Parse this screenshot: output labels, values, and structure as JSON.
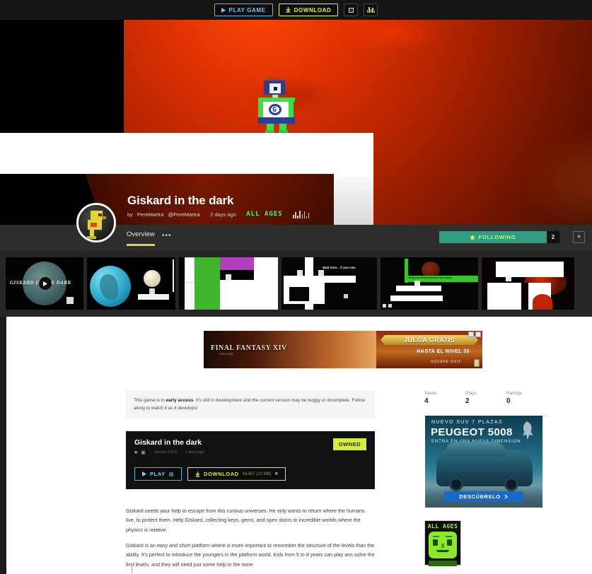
{
  "topbar": {
    "play_game_label": "PLAY GAME",
    "download_label": "DOWNLOAD",
    "play_icon": "play-triangle-icon",
    "download_icon": "download-arrow-icon",
    "fullscreen_icon": "fullscreen-icon",
    "stats_icon": "stats-bars-icon"
  },
  "hero": {
    "character": "pixel-robot-giskard",
    "chest_letter": "G"
  },
  "title": {
    "game_title": "Giskard in the dark",
    "by_prefix": "by",
    "author": "PereMartra",
    "handle": "@PereMartra",
    "posted": "2 days ago",
    "age_rating": "ALL AGES",
    "sep": "·"
  },
  "tabs": {
    "overview_label": "Overview",
    "more_label": "•••",
    "following_label": "FOLLOWING",
    "following_icon": "check-badge-icon",
    "following_count": "2",
    "add_label": "+"
  },
  "shots": {
    "first_caption": "GISKARD IN THE DARK",
    "play_icon": "play-circle-icon",
    "tip_text": "Wait here... if you can.",
    "green_bar_text": "Bring your friend before the door opens"
  },
  "ad_banner": {
    "brand": "FINAL FANTASY XIV",
    "brand_sub": "ONLINE",
    "headline": "JUEGA GRATIS",
    "subline": "HASTA EL NIVEL 35",
    "publisher": "SQUARE ENIX",
    "adchoices_icon": "adchoices-icon",
    "close_icon": "close-icon"
  },
  "notice": {
    "part1": "This game is in ",
    "bold": "early access",
    "part2": ". It's still in development and the current version may be buggy or incomplete. Follow along to watch it as it develops!"
  },
  "stats": [
    {
      "label": "Views",
      "value": "4"
    },
    {
      "label": "Plays",
      "value": "2"
    },
    {
      "label": "Ratings",
      "value": "0"
    }
  ],
  "download_panel": {
    "title": "Giskard in the dark",
    "platform_icons": "windows-linux-icons",
    "version": "Version 0.8.0",
    "updated": "2 days ago",
    "owned_badge": "OWNED",
    "play_label": "PLAY",
    "play_icon": "play-triangle-icon",
    "play_platform_icon": "monitor-icon",
    "download_label": "DOWNLOAD",
    "download_icon": "download-arrow-icon",
    "download_size": "64-BIT (23 MB)",
    "download_platform_icon": "windows-icon"
  },
  "description": {
    "p1": "Giskard needs your help to escape from this curious universes. He only wants to return where the humans live, to protect them. Help Giskard, collecting keys, gems, and open doors to incredible worlds where the physics is relative.",
    "p2": "Giskard is an easy and short platform where is more important to remember the structure of the levels than the ability. It's perfect to introduce the youngers in the platform world. Kids from 5 to 8 years can play ans solve the first levels, and they will need just some help in the more"
  },
  "ad_sidebar": {
    "eyebrow": "NUEVO SUV 7 PLAZAS",
    "model": "PEUGEOT 5008",
    "tagline": "ENTRA EN UNA NUEVA DIMENSION",
    "cta": "DESCÚBRELO",
    "cta_icon": "chevron-right-icon",
    "logo_icon": "peugeot-lion-icon"
  },
  "rating_badge": {
    "title": "ALL AGES",
    "face_icon": "pixel-face-icon"
  },
  "colors": {
    "accent_yellow": "#d8ec3d",
    "accent_blue": "#6fd2ea",
    "follow_green": "#2f9e82",
    "page_dark": "#262626",
    "tab_underline": "#dcd44a"
  }
}
